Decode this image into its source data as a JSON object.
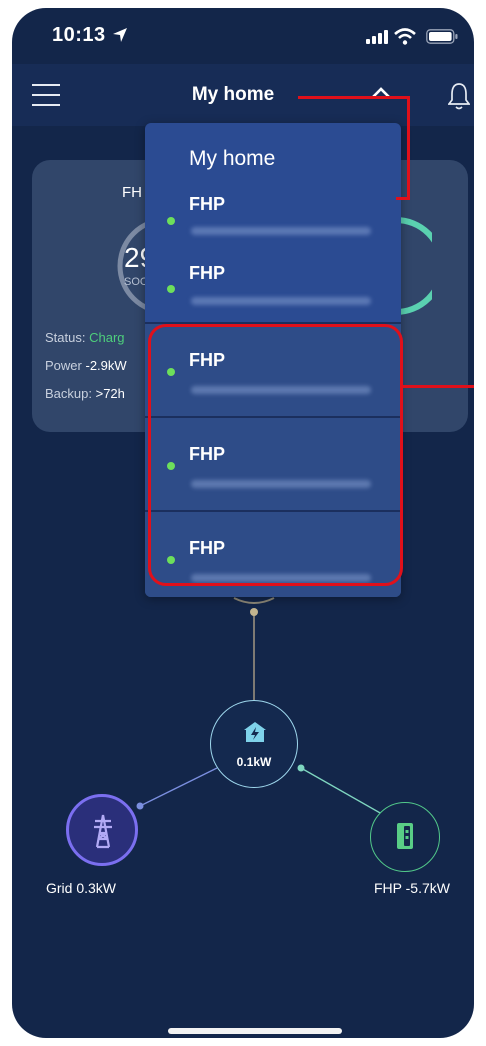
{
  "status_bar": {
    "time": "10:13"
  },
  "header": {
    "title": "My home"
  },
  "dropdown": {
    "title": "My home",
    "items": [
      {
        "label": "FHP"
      },
      {
        "label": "FHP"
      },
      {
        "label": "FHP"
      },
      {
        "label": "FHP"
      },
      {
        "label": "FHP"
      }
    ]
  },
  "battery_card": {
    "name_fragment": "FH",
    "soc_fragment": "29",
    "soc_label_fragment": "SOC",
    "status_label": "Status:",
    "status_value_fragment": "Charg",
    "power_label": "Power",
    "power_value_fragment": "-2.9kW",
    "backup_label": "Backup:",
    "backup_value_fragment": ">72h"
  },
  "energy_flow": {
    "home": {
      "value": "0.1kW"
    },
    "grid": {
      "label": "Grid 0.3kW"
    },
    "battery": {
      "label": "FHP -5.7kW"
    }
  },
  "colors": {
    "background": "#13264a",
    "header": "#172c56",
    "dropdown": "#2b4b92",
    "online_dot": "#6ddf5b",
    "annotation": "#e0101a",
    "grid_ring": "#7b6ff0",
    "battery_ring": "#52c98a",
    "home_ring": "#9fd8ee"
  }
}
